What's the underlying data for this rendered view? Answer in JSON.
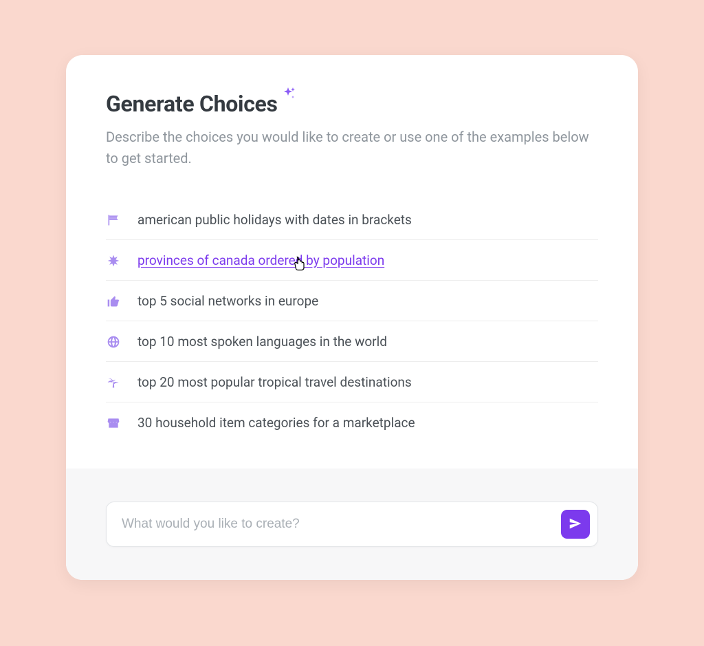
{
  "header": {
    "title": "Generate Choices",
    "subtitle": "Describe the choices you would like to create or use one of the examples below to get started."
  },
  "examples": [
    {
      "icon": "flag-icon",
      "label": "american public holidays with dates in brackets",
      "active": false
    },
    {
      "icon": "splat-icon",
      "label": "provinces of canada ordered by population",
      "active": true
    },
    {
      "icon": "thumbs-up-icon",
      "label": "top 5 social networks in europe",
      "active": false
    },
    {
      "icon": "globe-icon",
      "label": "top 10 most spoken languages in the world",
      "active": false
    },
    {
      "icon": "palm-tree-icon",
      "label": "top 20 most popular tropical travel destinations",
      "active": false
    },
    {
      "icon": "store-icon",
      "label": "30 household item categories for a marketplace",
      "active": false
    }
  ],
  "input": {
    "placeholder": "What would you like to create?",
    "value": ""
  },
  "colors": {
    "accent": "#7c3aed",
    "icon": "#a98df0"
  }
}
